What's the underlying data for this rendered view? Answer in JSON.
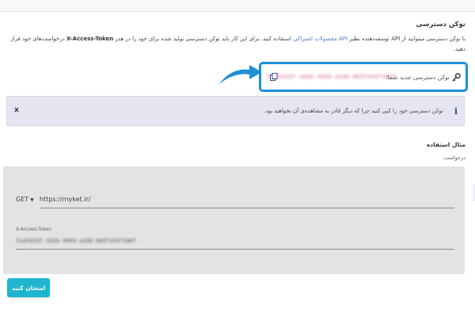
{
  "section": {
    "title": "توکن دسترسی",
    "description_part1": "با توکن دسترسی میتوانید از API توسعه‌دهنده نظیر ",
    "description_link": "API محصولات اشتراکی",
    "description_part2": " استفاده کنید. برای این کار باید توکن دسترسی تولید شده برای خود را در هدر ",
    "description_header": "X-Access-Token",
    "description_part3": " درخواست‌های خود قرار دهید."
  },
  "token": {
    "label": "توکن دسترسی جدید شما:",
    "value": "51a5919f-182b-4949-a2dd-0b97a597180f",
    "key_icon": "key-icon",
    "copy_icon": "copy-icon"
  },
  "info": {
    "icon": "i",
    "text": "توکن دسترسی خود را کپی کنید چرا که دیگر قادر به مشاهده‌ی آن نخواهید بود.",
    "close": "x"
  },
  "example": {
    "title": "مثال استفاده",
    "request_label": "درخواست:",
    "method": "GET",
    "url": "https://myket.ir/",
    "header_label": "X-Access-Token",
    "header_value": "51a5919f-182b-4949-a2dd-0b97a597180f"
  },
  "actions": {
    "test_button": "امتحان کنید"
  },
  "colors": {
    "accent": "#20b5cf",
    "highlight_border": "#1e90d6",
    "info_bg": "#e6e6f3",
    "panel_bg": "#e3e3e3"
  }
}
